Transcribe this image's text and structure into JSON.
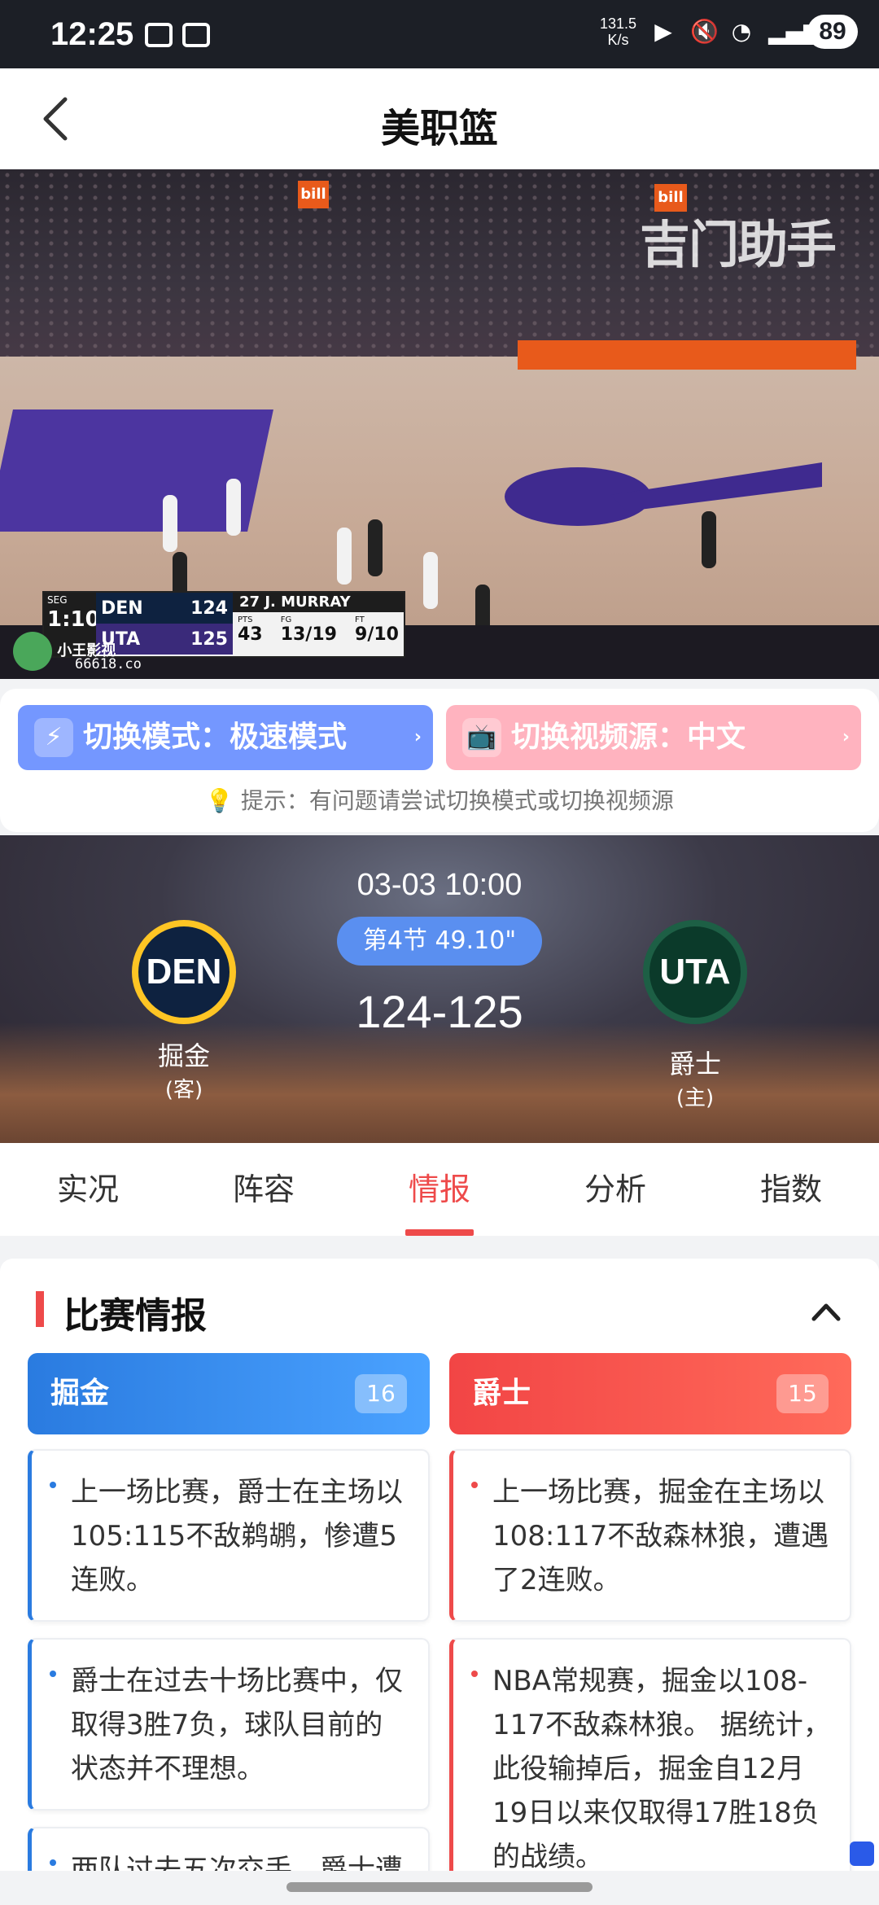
{
  "status_bar": {
    "time": "12:25",
    "net_speed_value": "131.5",
    "net_speed_unit": "K/s",
    "battery": "89"
  },
  "header": {
    "title": "美职篮"
  },
  "video": {
    "watermark": "吉门助手",
    "ad_text": "bill",
    "scorebug": {
      "segment": "SEG",
      "quarter_clock": "1:10",
      "team1": "DEN",
      "team1_score": "124",
      "team2": "UTA",
      "team2_score": "125",
      "player_number": "27",
      "player_name": "J. MURRAY",
      "stat_labels": [
        "PTS",
        "FG",
        "FT"
      ],
      "stat_values": [
        "43",
        "13/19",
        "9/10"
      ]
    },
    "brand_text": "小王影视",
    "brand_url": "66618.co"
  },
  "switch": {
    "mode_label": "切换模式：极速模式",
    "source_label": "切换视频源：中文",
    "arrow": "›",
    "tip": "提示：有问题请尝试切换模式或切换视频源"
  },
  "match": {
    "datetime": "03-03 10:00",
    "period": "第4节 49.10\"",
    "score": "124-125",
    "away": {
      "abbr": "DEN",
      "name": "掘金",
      "role": "(客)"
    },
    "home": {
      "abbr": "UTA",
      "name": "爵士",
      "role": "(主)"
    }
  },
  "tabs": [
    "实况",
    "阵容",
    "情报",
    "分析",
    "指数"
  ],
  "active_tab": "情报",
  "intel": {
    "title": "比赛情报",
    "left": {
      "team": "掘金",
      "count": "16",
      "items": [
        "上一场比赛，爵士在主场以105:115不敌鹈鹕，惨遭5连败。",
        "爵士在过去十场比赛中，仅取得3胜7负，球队目前的状态并不理想。",
        "两队过去五次交手，爵士遭"
      ]
    },
    "right": {
      "team": "爵士",
      "count": "15",
      "items": [
        "上一场比赛，掘金在主场以108:117不敌森林狼，遭遇了2连败。",
        "NBA常规赛，掘金以108-117不敌森林狼。 据统计，此役输掉后，掘金自12月19日以来仅取得17胜18负的战绩。"
      ]
    }
  }
}
